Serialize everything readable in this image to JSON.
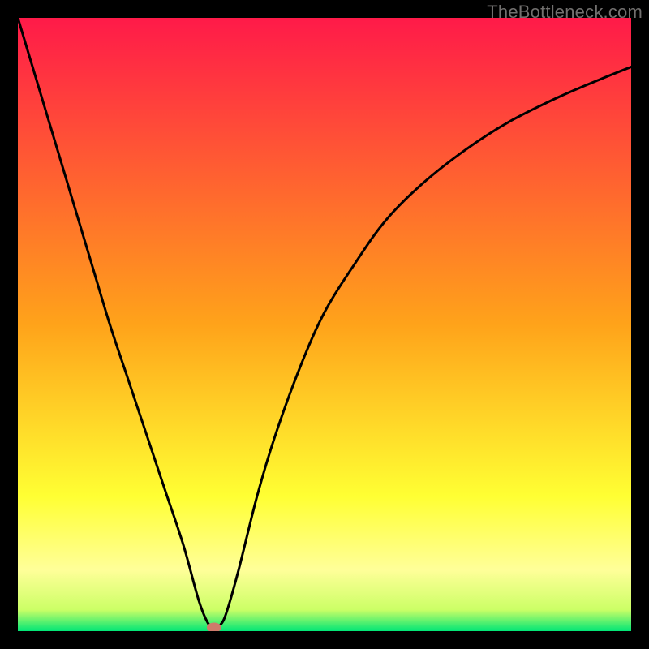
{
  "watermark": "TheBottleneck.com",
  "chart_data": {
    "type": "line",
    "title": "",
    "xlabel": "",
    "ylabel": "",
    "xlim": [
      0,
      100
    ],
    "ylim": [
      0,
      100
    ],
    "grid": false,
    "background_gradient": {
      "stops": [
        {
          "pos": 0.0,
          "color": "#ff1a49"
        },
        {
          "pos": 0.5,
          "color": "#ffa31a"
        },
        {
          "pos": 0.78,
          "color": "#ffff33"
        },
        {
          "pos": 0.9,
          "color": "#ffff99"
        },
        {
          "pos": 0.965,
          "color": "#ccff66"
        },
        {
          "pos": 1.0,
          "color": "#00e676"
        }
      ]
    },
    "series": [
      {
        "name": "bottleneck-curve",
        "color": "#000000",
        "x": [
          0,
          3,
          6,
          9,
          12,
          15,
          18,
          21,
          24,
          27,
          29.5,
          31,
          32,
          33,
          34,
          36,
          39,
          42,
          46,
          50,
          55,
          60,
          66,
          73,
          80,
          88,
          95,
          100
        ],
        "y": [
          100,
          90,
          80,
          70,
          60,
          50,
          41,
          32,
          23,
          14,
          5,
          1.3,
          0.6,
          1.0,
          3,
          10,
          22,
          32,
          43,
          52,
          60,
          67,
          73,
          78.5,
          83,
          87,
          90,
          92
        ]
      }
    ],
    "marker": {
      "name": "optimum-point",
      "x": 32,
      "y": 0.6,
      "color": "#cf7a6b",
      "rx": 9,
      "ry": 6
    }
  }
}
